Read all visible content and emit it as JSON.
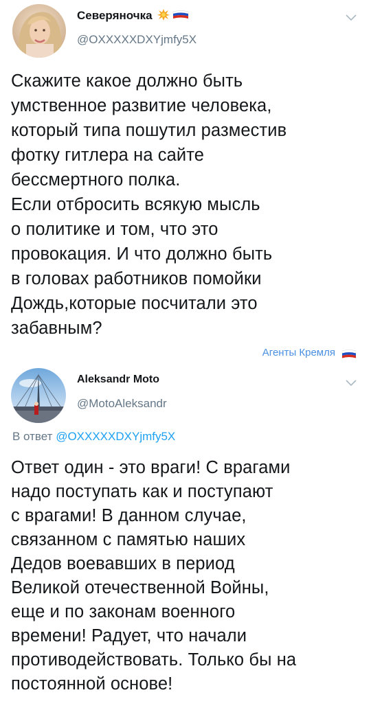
{
  "tweets": [
    {
      "display_name": "Северяночка",
      "handle": "@OXXXXXDXYjmfy5X",
      "name_decorations": [
        "starburst-icon",
        "russian-flag-icon"
      ],
      "lines": [
        "Скажите какое должно быть",
        "умственное развитие человека,",
        "который типа пошутил разместив",
        "фотку гитлера на сайте",
        "бессмертного полка.",
        "Если отбросить всякую мысль",
        "о политике и том, что это",
        "провокация. И что должно быть",
        "в головах работников помойки",
        "Дождь,которые посчитали это",
        "забавным?"
      ],
      "badge": "Агенты Кремля"
    },
    {
      "display_name": "Aleksandr Moto",
      "handle": "@MotoAleksandr",
      "reply_prefix": "В ответ",
      "reply_mention": "@OXXXXXDXYjmfy5X",
      "lines": [
        "Ответ один - это враги! С врагами",
        "надо поступать как и поступают",
        "с врагами! В данном случае,",
        "связанном с памятью наших",
        "Дедов воевавших в период",
        "Великой отечественной Войны,",
        "еще и по законам военного",
        "времени! Радует, что начали",
        "противодействовать. Только бы на",
        "постоянной основе!"
      ]
    }
  ],
  "colors": {
    "text": "#14171a",
    "secondary": "#657786",
    "link": "#1da1f2",
    "badge": "#4a90e2",
    "flag_white": "#ffffff",
    "flag_blue": "#1c4fc4",
    "flag_red": "#d52b1e"
  }
}
